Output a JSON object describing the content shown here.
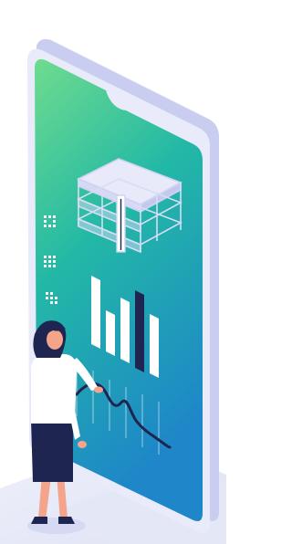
{
  "illustration": {
    "subject": "woman-presenting-on-smartphone-dashboard",
    "colors": {
      "gradient_top": "#6fdc8e",
      "gradient_mid": "#22b8a6",
      "gradient_bottom": "#1e86c9",
      "phone_frame": "#e9ebfb",
      "phone_edge": "#c9cdef",
      "floor": "#eceef9",
      "bar_white": "#ffffff",
      "bar_navy": "#1d2550",
      "trend_line": "#1d2550",
      "hair": "#1d2550",
      "shirt": "#ffffff",
      "skirt": "#1d2550",
      "skin": "#f4a48b"
    },
    "icons": [
      "grid-icon",
      "grid-icon",
      "grid-icon"
    ],
    "bar_chart": {
      "bar_count": 5,
      "highlighted_index": 3
    }
  }
}
